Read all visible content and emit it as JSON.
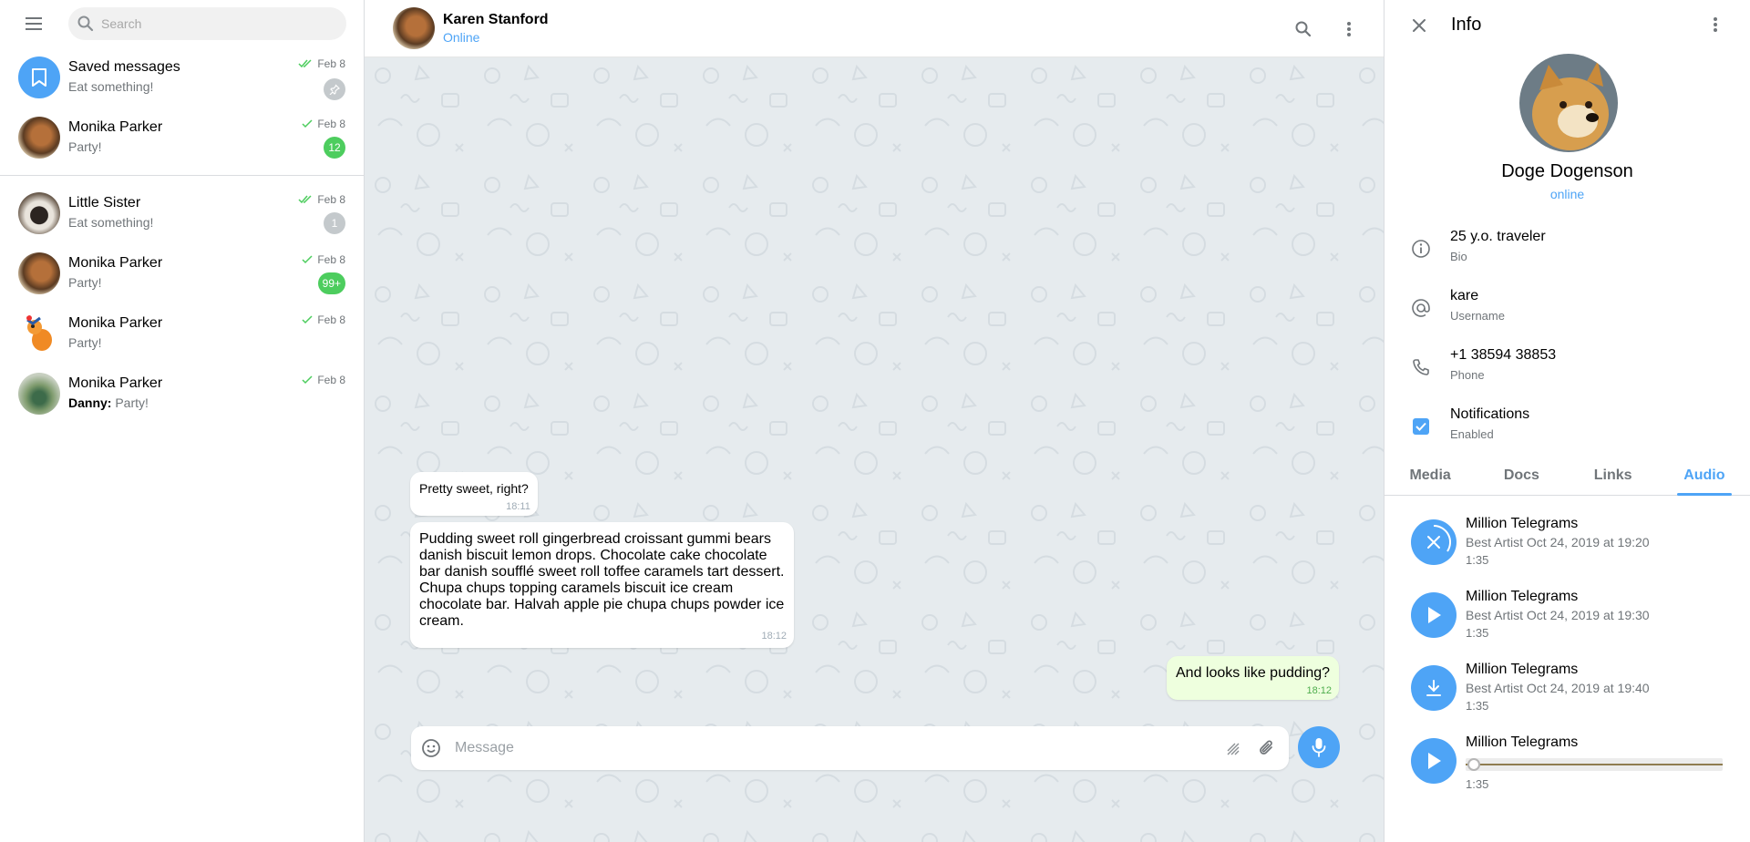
{
  "sidebar": {
    "search_placeholder": "Search",
    "chats": [
      {
        "name": "Saved messages",
        "message": "Eat something!",
        "date": "Feb 8",
        "ticks": "double",
        "badge": "",
        "badge_kind": "pin",
        "avatar": "saved"
      },
      {
        "name": "Monika Parker",
        "message": "Party!",
        "date": "Feb 8",
        "ticks": "single",
        "badge": "12",
        "badge_kind": "green",
        "avatar": "dog"
      },
      {
        "name": "Little Sister",
        "message": "Eat something!",
        "date": "Feb 8",
        "ticks": "double",
        "badge": "1",
        "badge_kind": "grey",
        "avatar": "cat"
      },
      {
        "name": "Monika Parker",
        "message": "Party!",
        "date": "Feb 8",
        "ticks": "single",
        "badge": "99+",
        "badge_kind": "green",
        "avatar": "dog"
      },
      {
        "name": "Monika Parker",
        "message": "Party!",
        "date": "Feb 8",
        "ticks": "single",
        "badge": "",
        "badge_kind": "none",
        "avatar": "squirrel"
      },
      {
        "name": "Monika Parker",
        "sender": "Danny:",
        "message": "Party!",
        "date": "Feb 8",
        "ticks": "single",
        "badge": "",
        "badge_kind": "none",
        "avatar": "peacock"
      }
    ]
  },
  "header": {
    "name": "Karen Stanford",
    "status": "Online"
  },
  "messages": [
    {
      "text": "Pretty sweet, right?",
      "time": "18:11",
      "direction": "in"
    },
    {
      "text": "Pudding sweet roll gingerbread croissant gummi bears danish biscuit lemon drops. Chocolate cake chocolate bar danish soufflé sweet roll toffee caramels tart dessert. Chupa chups topping caramels biscuit ice cream chocolate bar. Halvah apple pie chupa chups powder ice cream.",
      "time": "18:12",
      "direction": "in"
    },
    {
      "text": "And looks like pudding?",
      "time": "18:12",
      "direction": "out"
    }
  ],
  "composer": {
    "placeholder": "Message"
  },
  "info": {
    "title": "Info",
    "name": "Doge Dogenson",
    "status": "online",
    "rows": [
      {
        "value": "25 y.o. traveler",
        "label": "Bio",
        "icon": "info-icon"
      },
      {
        "value": "kare",
        "label": "Username",
        "icon": "at-icon"
      },
      {
        "value": "+1 38594 38853",
        "label": "Phone",
        "icon": "phone-icon"
      },
      {
        "value": "Notifications",
        "label": "Enabled",
        "icon": "checkbox-icon"
      }
    ],
    "tabs": [
      "Media",
      "Docs",
      "Links",
      "Audio"
    ],
    "active_tab": "Audio",
    "audio": [
      {
        "title": "Million Telegrams",
        "subtitle": "Best Artist Oct 24, 2019 at 19:20",
        "duration": "1:35",
        "state": "loading"
      },
      {
        "title": "Million Telegrams",
        "subtitle": "Best Artist Oct 24, 2019 at 19:30",
        "duration": "1:35",
        "state": "play"
      },
      {
        "title": "Million Telegrams",
        "subtitle": "Best Artist Oct 24, 2019 at 19:40",
        "duration": "1:35",
        "state": "download"
      },
      {
        "title": "Million Telegrams",
        "subtitle": "",
        "duration": "1:35",
        "state": "playing-seek",
        "progress": 0
      }
    ]
  },
  "colors": {
    "accent": "#4ea4f6",
    "badge_green": "#4dcd5e",
    "out_bubble": "#eeffde",
    "chat_bg": "#e6ebee"
  }
}
